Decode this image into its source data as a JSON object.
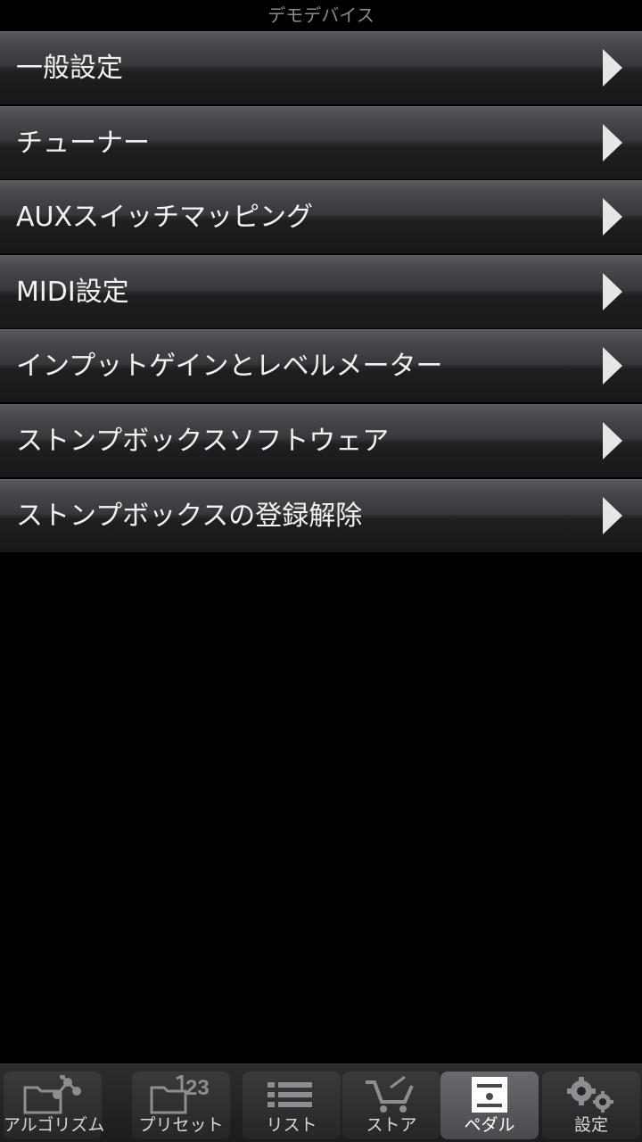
{
  "header": {
    "title": "デモデバイス"
  },
  "menu": {
    "items": [
      {
        "label": "一般設定"
      },
      {
        "label": "チューナー"
      },
      {
        "label": "AUXスイッチマッピング"
      },
      {
        "label": "MIDI設定"
      },
      {
        "label": "インプットゲインとレベルメーター"
      },
      {
        "label": "ストンプボックスソフトウェア"
      },
      {
        "label": "ストンプボックスの登録解除"
      }
    ]
  },
  "tabbar": {
    "tabs": [
      {
        "label": "アルゴリズム",
        "icon": "algorithm-folder-icon"
      },
      {
        "label": "プリセット",
        "icon": "preset-folder-icon",
        "icon_text": "23"
      },
      {
        "label": "リスト",
        "icon": "list-icon"
      },
      {
        "label": "ストア",
        "icon": "cart-icon"
      },
      {
        "label": "ペダル",
        "icon": "pedal-icon"
      },
      {
        "label": "設定",
        "icon": "gears-icon"
      }
    ],
    "active": "ペダル"
  },
  "colors": {
    "background": "#000000",
    "header_text": "#8a8a8a",
    "menu_text": "#f2f2f2",
    "chevron": "#e6e6e6"
  }
}
